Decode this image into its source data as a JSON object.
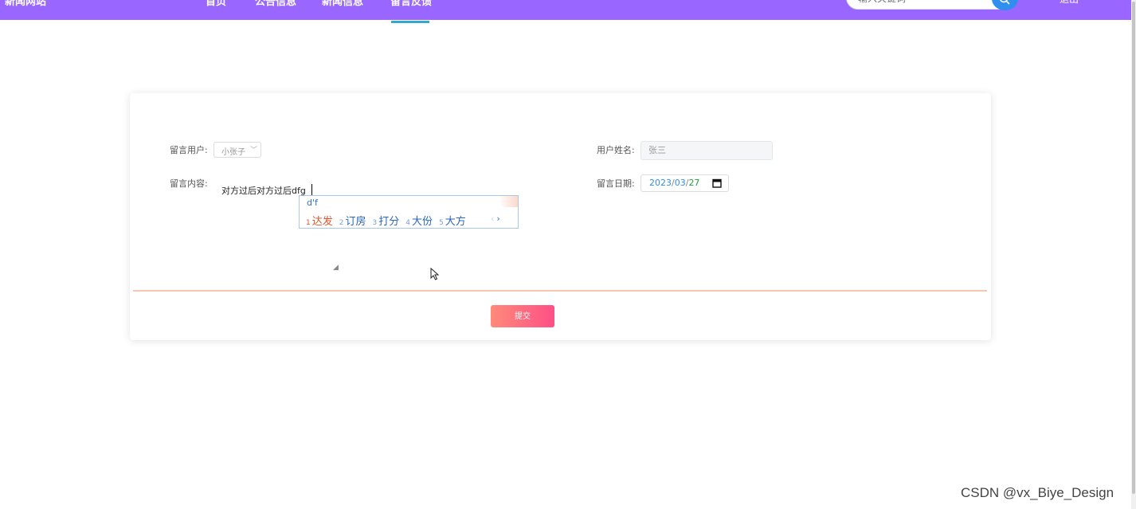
{
  "header": {
    "brand": "新闻网站",
    "nav": [
      "首页",
      "公告信息",
      "新闻信息",
      "留言反馈"
    ],
    "active_index": 3,
    "search_placeholder": "输入关键词",
    "user_label": "退出"
  },
  "form": {
    "user_label": "留言用户:",
    "user_value": "小张子",
    "name_label": "用户姓名:",
    "name_value": "张三",
    "content_label": "留言内容:",
    "content_value": "对方过后对方过后dfg",
    "date_label": "留言日期:",
    "date_year": "2023",
    "date_month": "03",
    "date_day": "27",
    "date_sep": "/",
    "submit_label": "提交"
  },
  "ime": {
    "composition": "d'f",
    "candidates": [
      {
        "num": "1",
        "text": "达发"
      },
      {
        "num": "2",
        "text": "订房"
      },
      {
        "num": "3",
        "text": "打分"
      },
      {
        "num": "4",
        "text": "大份"
      },
      {
        "num": "5",
        "text": "大方"
      }
    ],
    "prev": "‹",
    "next": "›"
  },
  "watermark": "CSDN @vx_Biye_Design",
  "colors": {
    "topbar": "#9966ff",
    "submit_from": "#ff8a7a",
    "submit_to": "#ff4f86",
    "divider": "#f7c6b3"
  }
}
